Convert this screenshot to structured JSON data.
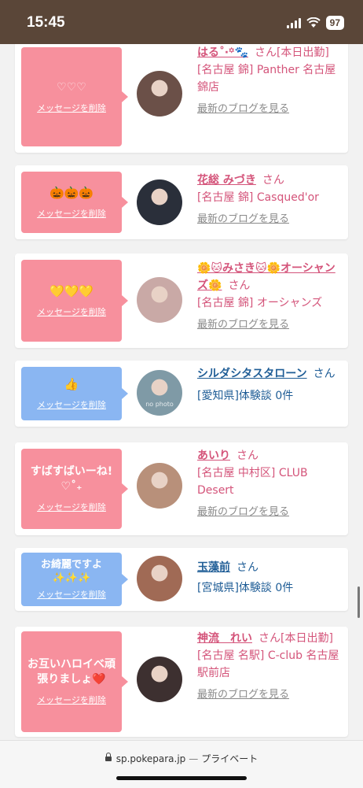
{
  "status": {
    "time": "15:45",
    "battery": "97"
  },
  "cards": [
    {
      "theme": "pink",
      "message": "♡♡♡",
      "delete_label": "メッセージを削除",
      "name": "はる˚‧꙳🐾",
      "san": "さん",
      "shop": "[本日出勤] [名古屋 錦] Panther 名古屋錦店",
      "blog": "最新のブログを見る",
      "avatar_color": "#6b5048"
    },
    {
      "theme": "pink",
      "message": "🎃🎃🎃",
      "delete_label": "メッセージを削除",
      "name": "花総 みづき",
      "san": "さん",
      "shop": "[名古屋 錦] Casqued'or",
      "blog": "最新のブログを見る",
      "avatar_color": "#2a2f3a"
    },
    {
      "theme": "pink",
      "message": "💛💛💛",
      "delete_label": "メッセージを削除",
      "name": "🌼🐱みさき🐱🌼オーシャンズ🌼",
      "san": "さん",
      "shop": "[名古屋 錦] オーシャンズ",
      "blog": "最新のブログを見る",
      "avatar_color": "#c9a9a6"
    },
    {
      "theme": "blue",
      "message": "👍",
      "delete_label": "メッセージを削除",
      "name": "シルダシタスタローン",
      "san": "さん",
      "shop": "[愛知県]体験談 0件",
      "blog": "",
      "avatar_color": "#7f9aa6",
      "avatar_text": "no photo"
    },
    {
      "theme": "pink",
      "message": "すばすばいーね!♡˚₊",
      "delete_label": "メッセージを削除",
      "name": "あいり",
      "san": "さん",
      "shop": "[名古屋 中村区] CLUB Desert",
      "blog": "最新のブログを見る",
      "avatar_color": "#b8907a"
    },
    {
      "theme": "blue",
      "message": "お綺麗ですよ✨✨✨",
      "delete_label": "メッセージを削除",
      "name": "玉藻前",
      "san": "さん",
      "shop": "[宮城県]体験談 0件",
      "blog": "",
      "avatar_color": "#a06a55"
    },
    {
      "theme": "pink",
      "message": "お互いハロイベ頑張りましょ❤️",
      "delete_label": "メッセージを削除",
      "name": "神流　れい",
      "san": "さん",
      "shop": "[本日出勤] [名古屋 名駅] C-club 名古屋駅前店",
      "blog": "最新のブログを見る",
      "avatar_color": "#3d3030"
    }
  ],
  "urlbar": {
    "domain": "sp.pokepara.jp",
    "separator": "—",
    "mode": "プライベート"
  }
}
